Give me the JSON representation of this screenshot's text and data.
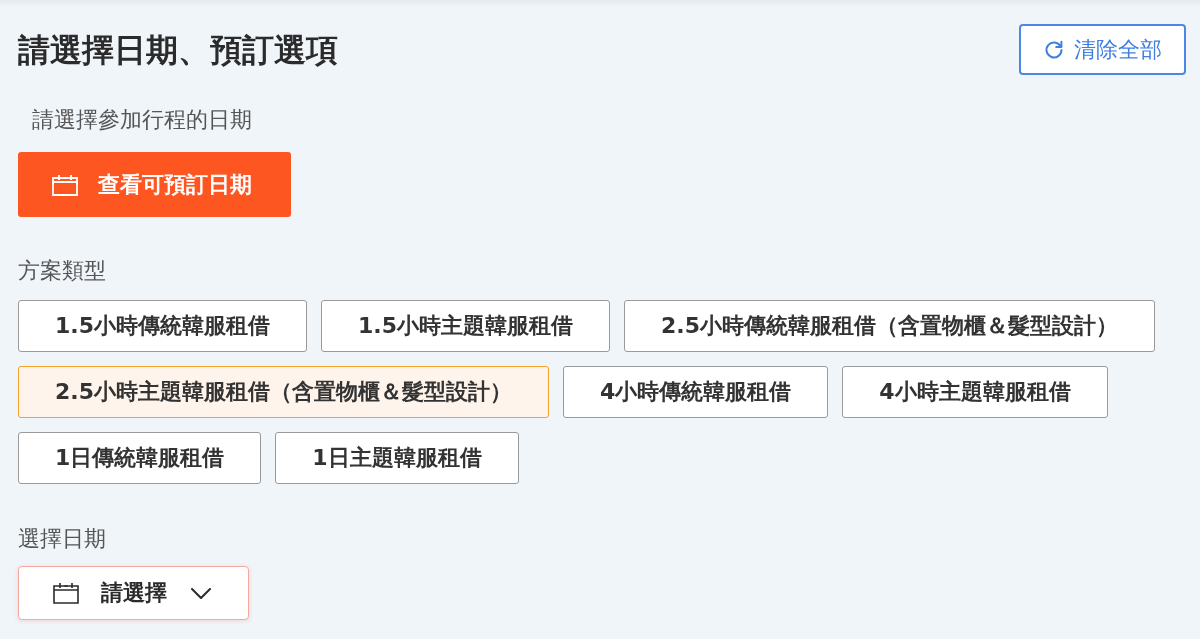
{
  "header": {
    "title": "請選擇日期、預訂選項",
    "clear_button": "清除全部"
  },
  "date_prompt": "請選擇參加行程的日期",
  "view_dates_button": "查看可預訂日期",
  "plan_type": {
    "label": "方案類型",
    "options": [
      {
        "label": "1.5小時傳統韓服租借",
        "selected": false
      },
      {
        "label": "1.5小時主題韓服租借",
        "selected": false
      },
      {
        "label": "2.5小時傳統韓服租借（含置物櫃＆髮型設計）",
        "selected": false
      },
      {
        "label": "2.5小時主題韓服租借（含置物櫃＆髮型設計）",
        "selected": true
      },
      {
        "label": "4小時傳統韓服租借",
        "selected": false
      },
      {
        "label": "4小時主題韓服租借",
        "selected": false
      },
      {
        "label": "1日傳統韓服租借",
        "selected": false
      },
      {
        "label": "1日主題韓服租借",
        "selected": false
      }
    ]
  },
  "date_select": {
    "label": "選擇日期",
    "placeholder": "請選擇"
  }
}
